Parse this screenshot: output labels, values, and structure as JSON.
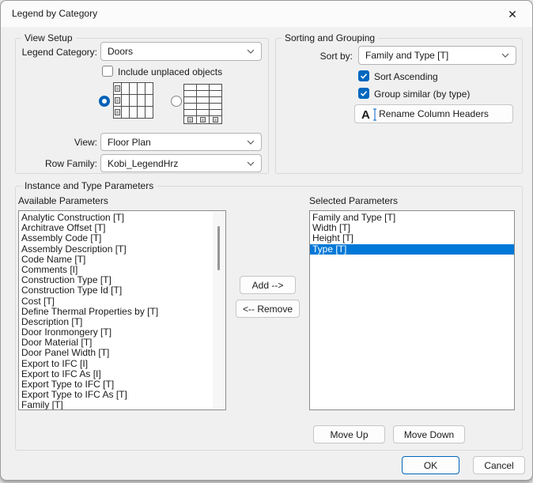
{
  "window": {
    "title": "Legend by Category",
    "close_glyph": "✕"
  },
  "view_setup": {
    "label": "View Setup",
    "legend_category": {
      "label": "Legend Category:",
      "value": "Doors"
    },
    "include_unplaced": {
      "label": "Include unplaced objects",
      "checked": false
    },
    "layout": {
      "horizontal_selected": true,
      "vertical_selected": false
    },
    "view": {
      "label": "View:",
      "value": "Floor Plan"
    },
    "row_family": {
      "label": "Row Family:",
      "value": "Kobi_LegendHrz"
    }
  },
  "sorting": {
    "label": "Sorting and Grouping",
    "sort_by": {
      "label": "Sort by:",
      "value": "Family and Type [T]"
    },
    "sort_ascending": {
      "label": "Sort Ascending",
      "checked": true
    },
    "group_similar": {
      "label": "Group similar (by type)",
      "checked": true
    },
    "rename_button": "Rename Column Headers"
  },
  "parameters": {
    "label": "Instance and Type Parameters",
    "available": {
      "label": "Available Parameters",
      "items": [
        "Analytic Construction [T]",
        "Architrave Offset [T]",
        "Assembly Code [T]",
        "Assembly Description [T]",
        "Code Name [T]",
        "Comments [I]",
        "Construction Type [T]",
        "Construction Type Id [T]",
        "Cost [T]",
        "Define Thermal Properties by [T]",
        "Description [T]",
        "Door Ironmongery [T]",
        "Door Material [T]",
        "Door Panel Width [T]",
        "Export to IFC [I]",
        "Export to IFC As [I]",
        "Export Type to IFC [T]",
        "Export Type to IFC As [T]",
        "Family [T]"
      ]
    },
    "selected": {
      "label": "Selected Parameters",
      "items": [
        "Family and Type [T]",
        "Width [T]",
        "Height [T]",
        "Type [T]"
      ],
      "highlighted_index": 3
    },
    "add_button": "Add -->",
    "remove_button": "<-- Remove",
    "move_up_button": "Move Up",
    "move_down_button": "Move Down"
  },
  "footer": {
    "ok": "OK",
    "cancel": "Cancel"
  },
  "colors": {
    "accent": "#0067c0",
    "list_highlight": "#0078d7",
    "titlebar_bg": "#fbfbfb",
    "dialog_bg": "#f0f0f0"
  }
}
